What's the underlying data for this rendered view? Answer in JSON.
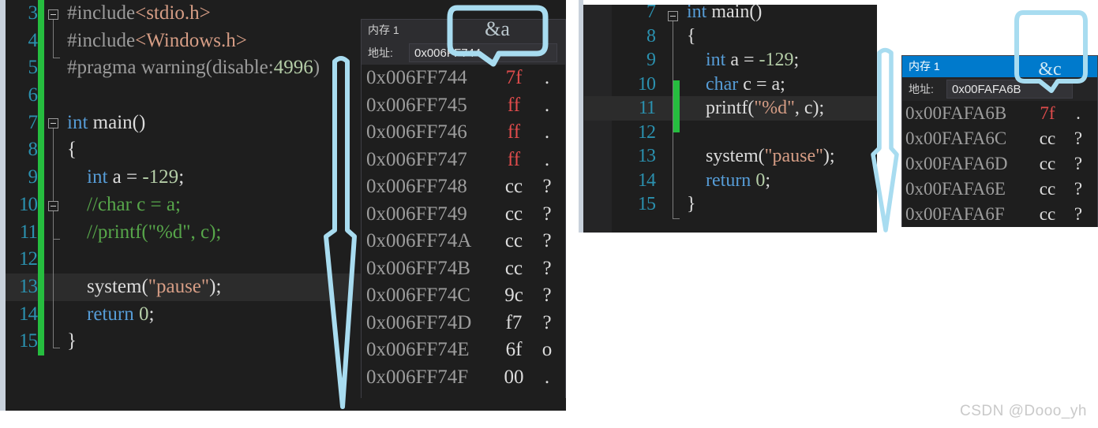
{
  "colors": {
    "editor_bg": "#1e1e1e",
    "gutter_bg": "#252526",
    "line_number": "#2b91af",
    "change_bar_green": "#26bd3f",
    "keyword_blue": "#569cd6",
    "string_orange": "#d69d85",
    "comment_green": "#57a64a",
    "number_green": "#b5cea8",
    "annotation_blue": "#a8dcf0",
    "title_active_blue": "#007acc",
    "hex_red": "#e04c4c",
    "exec_arrow_yellow": "#f0c03c"
  },
  "left_editor": {
    "name": "source-code-editor-left",
    "first_line": 3,
    "highlighted_line": 13,
    "lines": [
      {
        "num": "3",
        "fold": "open",
        "tokens": [
          {
            "t": "#include",
            "c": "pre"
          },
          {
            "t": "<stdio.h>",
            "c": "hdr"
          }
        ]
      },
      {
        "num": "4",
        "fold": "none",
        "tokens": [
          {
            "t": "#include",
            "c": "pre"
          },
          {
            "t": "<Windows.h>",
            "c": "hdr"
          }
        ]
      },
      {
        "num": "5",
        "fold": "none",
        "tokens": [
          {
            "t": "#pragma warning(disable:",
            "c": "pre"
          },
          {
            "t": "4996",
            "c": "num"
          },
          {
            "t": ")",
            "c": "pre"
          }
        ]
      },
      {
        "num": "6",
        "fold": "none",
        "tokens": []
      },
      {
        "num": "7",
        "fold": "open",
        "tokens": [
          {
            "t": "int",
            "c": "kw"
          },
          {
            "t": " main()",
            "c": "plain"
          }
        ]
      },
      {
        "num": "8",
        "fold": "none",
        "tokens": [
          {
            "t": "{",
            "c": "plain"
          }
        ]
      },
      {
        "num": "9",
        "fold": "none",
        "tokens": [
          {
            "t": "    int",
            "c": "kw"
          },
          {
            "t": " a = ",
            "c": "plain"
          },
          {
            "t": "-129",
            "c": "num"
          },
          {
            "t": ";",
            "c": "plain"
          }
        ]
      },
      {
        "num": "10",
        "fold": "open",
        "tokens": [
          {
            "t": "    //char c = a;",
            "c": "cmt"
          }
        ]
      },
      {
        "num": "11",
        "fold": "none",
        "tokens": [
          {
            "t": "    //printf(\"%d\", c);",
            "c": "cmt"
          }
        ]
      },
      {
        "num": "12",
        "fold": "none",
        "tokens": []
      },
      {
        "num": "13",
        "fold": "none",
        "tokens": [
          {
            "t": "    system(",
            "c": "plain"
          },
          {
            "t": "\"pause\"",
            "c": "str"
          },
          {
            "t": ");",
            "c": "plain"
          }
        ]
      },
      {
        "num": "14",
        "fold": "none",
        "tokens": [
          {
            "t": "    return",
            "c": "kw"
          },
          {
            "t": " ",
            "c": "plain"
          },
          {
            "t": "0",
            "c": "num"
          },
          {
            "t": ";",
            "c": "plain"
          }
        ]
      },
      {
        "num": "15",
        "fold": "none",
        "tokens": [
          {
            "t": "}",
            "c": "plain"
          }
        ]
      }
    ]
  },
  "right_editor": {
    "name": "source-code-editor-right",
    "first_line": 7,
    "highlighted_line": 11,
    "execution_line": 11,
    "lines": [
      {
        "num": "7",
        "fold": "open",
        "tokens": [
          {
            "t": "int",
            "c": "kw"
          },
          {
            "t": " main()",
            "c": "plain"
          }
        ]
      },
      {
        "num": "8",
        "fold": "none",
        "tokens": [
          {
            "t": "{",
            "c": "plain"
          }
        ]
      },
      {
        "num": "9",
        "fold": "none",
        "tokens": [
          {
            "t": "    int",
            "c": "kw"
          },
          {
            "t": " a = ",
            "c": "plain"
          },
          {
            "t": "-129",
            "c": "num"
          },
          {
            "t": ";",
            "c": "plain"
          }
        ]
      },
      {
        "num": "10",
        "fold": "none",
        "tokens": [
          {
            "t": "    char",
            "c": "kw"
          },
          {
            "t": " c = a;",
            "c": "plain"
          }
        ]
      },
      {
        "num": "11",
        "fold": "none",
        "tokens": [
          {
            "t": "    printf(",
            "c": "plain"
          },
          {
            "t": "\"%d\"",
            "c": "str"
          },
          {
            "t": ", c);",
            "c": "plain"
          }
        ]
      },
      {
        "num": "12",
        "fold": "none",
        "tokens": []
      },
      {
        "num": "13",
        "fold": "none",
        "tokens": [
          {
            "t": "    system(",
            "c": "plain"
          },
          {
            "t": "\"pause\"",
            "c": "str"
          },
          {
            "t": ");",
            "c": "plain"
          }
        ]
      },
      {
        "num": "14",
        "fold": "none",
        "tokens": [
          {
            "t": "    return",
            "c": "kw"
          },
          {
            "t": " ",
            "c": "plain"
          },
          {
            "t": "0",
            "c": "num"
          },
          {
            "t": ";",
            "c": "plain"
          }
        ]
      },
      {
        "num": "15",
        "fold": "none",
        "tokens": [
          {
            "t": "}",
            "c": "plain"
          }
        ]
      }
    ]
  },
  "memory_left": {
    "name": "memory-window-1-a",
    "title": "内存 1",
    "address_label": "地址:",
    "address_value": "0x006FF744",
    "active": false,
    "rows": [
      {
        "address": "0x006FF744",
        "hex": "7f",
        "ascii": ".",
        "hex_style": "red"
      },
      {
        "address": "0x006FF745",
        "hex": "ff",
        "ascii": ".",
        "hex_style": "red"
      },
      {
        "address": "0x006FF746",
        "hex": "ff",
        "ascii": ".",
        "hex_style": "red"
      },
      {
        "address": "0x006FF747",
        "hex": "ff",
        "ascii": ".",
        "hex_style": "red"
      },
      {
        "address": "0x006FF748",
        "hex": "cc",
        "ascii": "?",
        "hex_style": "norm"
      },
      {
        "address": "0x006FF749",
        "hex": "cc",
        "ascii": "?",
        "hex_style": "norm"
      },
      {
        "address": "0x006FF74A",
        "hex": "cc",
        "ascii": "?",
        "hex_style": "norm"
      },
      {
        "address": "0x006FF74B",
        "hex": "cc",
        "ascii": "?",
        "hex_style": "norm"
      },
      {
        "address": "0x006FF74C",
        "hex": "9c",
        "ascii": "?",
        "hex_style": "norm"
      },
      {
        "address": "0x006FF74D",
        "hex": "f7",
        "ascii": "?",
        "hex_style": "norm"
      },
      {
        "address": "0x006FF74E",
        "hex": "6f",
        "ascii": "o",
        "hex_style": "norm"
      },
      {
        "address": "0x006FF74F",
        "hex": "00",
        "ascii": ".",
        "hex_style": "norm"
      }
    ]
  },
  "memory_right": {
    "name": "memory-window-1-c",
    "title": "内存 1",
    "address_label": "地址:",
    "address_value": "0x00FAFA6B",
    "active": true,
    "rows": [
      {
        "address": "0x00FAFA6B",
        "hex": "7f",
        "ascii": ".",
        "hex_style": "red"
      },
      {
        "address": "0x00FAFA6C",
        "hex": "cc",
        "ascii": "?",
        "hex_style": "norm"
      },
      {
        "address": "0x00FAFA6D",
        "hex": "cc",
        "ascii": "?",
        "hex_style": "norm"
      },
      {
        "address": "0x00FAFA6E",
        "hex": "cc",
        "ascii": "?",
        "hex_style": "norm"
      },
      {
        "address": "0x00FAFA6F",
        "hex": "cc",
        "ascii": "?",
        "hex_style": "norm"
      }
    ]
  },
  "annotations": {
    "callout_left_label": "&a",
    "callout_right_label": "&c",
    "arrow_left_name": "hand-drawn-arrow-left",
    "arrow_right_name": "hand-drawn-arrow-right"
  },
  "watermark": {
    "text": "CSDN @Dooo_yh"
  }
}
